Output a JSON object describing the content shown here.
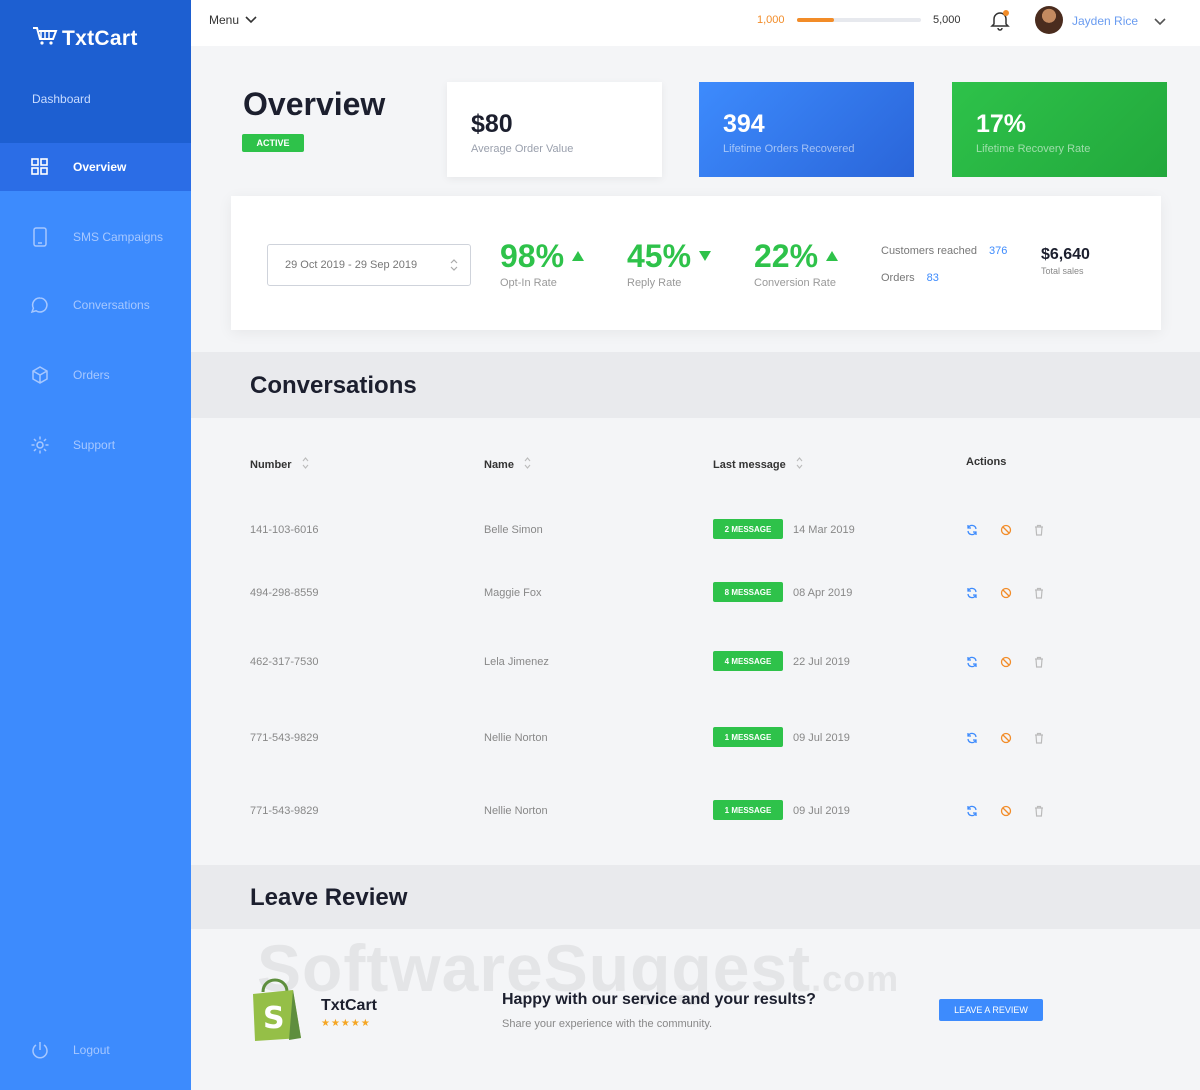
{
  "app": {
    "name": "TxtCart"
  },
  "sidebar": {
    "section_label": "Dashboard",
    "items": [
      {
        "label": "Overview",
        "icon": "grid-icon"
      },
      {
        "label": "SMS Campaigns",
        "icon": "phone-icon"
      },
      {
        "label": "Conversations",
        "icon": "chat-bubble-icon"
      },
      {
        "label": "Orders",
        "icon": "box-icon"
      },
      {
        "label": "Support",
        "icon": "gear-icon"
      }
    ],
    "logout_label": "Logout"
  },
  "topbar": {
    "menu_label": "Menu",
    "progress": {
      "min_label": "1,000",
      "max_label": "5,000",
      "fill_fraction": 0.3
    },
    "user_name": "Jayden Rice"
  },
  "overview": {
    "title": "Overview",
    "status_badge": "ACTIVE",
    "cards": [
      {
        "value": "$80",
        "label": "Average Order Value"
      },
      {
        "value": "394",
        "label": "Lifetime Orders Recovered"
      },
      {
        "value": "17%",
        "label": "Lifetime Recovery Rate"
      }
    ]
  },
  "stats": {
    "date_range": "29 Oct 2019 - 29 Sep 2019",
    "items": [
      {
        "value": "98%",
        "label": "Opt-In Rate",
        "trend": "up"
      },
      {
        "value": "45%",
        "label": "Reply Rate",
        "trend": "down"
      },
      {
        "value": "22%",
        "label": "Conversion Rate",
        "trend": "up"
      }
    ],
    "customers_reached_label": "Customers reached",
    "customers_reached_value": "376",
    "orders_label": "Orders",
    "orders_value": "83",
    "total_sales_value": "$6,640",
    "total_sales_label": "Total sales"
  },
  "conversations": {
    "title": "Conversations",
    "columns": [
      "Number",
      "Name",
      "Last message",
      "Actions"
    ],
    "rows": [
      {
        "number": "141-103-6016",
        "name": "Belle Simon",
        "badge": "2 MESSAGE",
        "date": "14 Mar 2019"
      },
      {
        "number": "494-298-8559",
        "name": "Maggie Fox",
        "badge": "8 MESSAGE",
        "date": "08 Apr 2019"
      },
      {
        "number": "462-317-7530",
        "name": "Lela Jimenez",
        "badge": "4 MESSAGE",
        "date": "22 Jul 2019"
      },
      {
        "number": "771-543-9829",
        "name": "Nellie Norton",
        "badge": "1 MESSAGE",
        "date": "09 Jul 2019"
      },
      {
        "number": "771-543-9829",
        "name": "Nellie Norton",
        "badge": "1 MESSAGE",
        "date": "09 Jul 2019"
      }
    ]
  },
  "review": {
    "title": "Leave Review",
    "brand": "TxtCart",
    "stars": "★★★★★",
    "question": "Happy with our service and your results?",
    "subtitle": "Share your experience with the community.",
    "button_label": "LEAVE A REVIEW"
  },
  "watermark": {
    "main": "SoftwareSuggest",
    "suffix": ".com"
  },
  "colors": {
    "sidebar": "#3d8bfd",
    "sidebar_head": "#1d5fd1",
    "green": "#2ec24a",
    "blue": "#3d8bfd",
    "orange": "#f28c28"
  }
}
